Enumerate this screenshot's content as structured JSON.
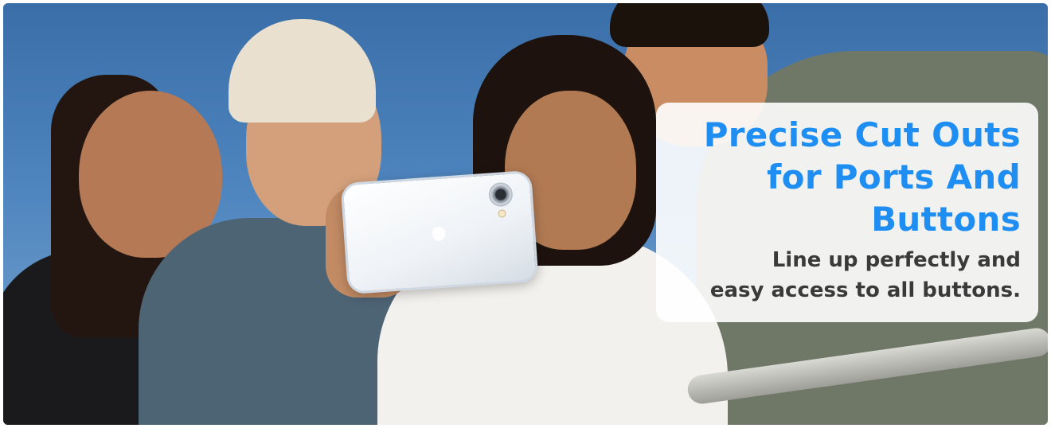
{
  "banner": {
    "headline_lines": [
      "Precise Cut Outs",
      "for Ports And",
      "Buttons"
    ],
    "subline_lines": [
      "Line up perfectly and",
      "easy access to all buttons."
    ],
    "colors": {
      "headline": "#1f8ef2",
      "subline": "#3a3a3a",
      "card_bg": "#ffffff"
    },
    "icons": {
      "phone": "phone-case-icon",
      "camera": "camera-lens-icon"
    }
  }
}
